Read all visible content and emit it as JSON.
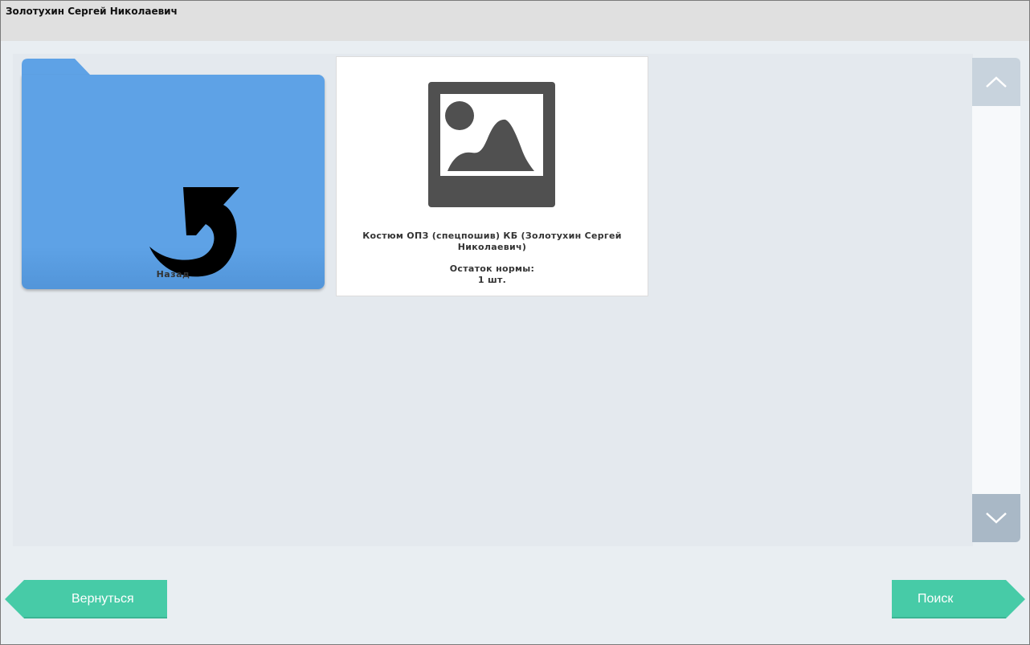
{
  "header": {
    "title": "Золотухин Сергей Николаевич"
  },
  "folder": {
    "label": "Назад",
    "icon": "undo-arrow-icon",
    "color": "#5ea2e6"
  },
  "item_card": {
    "image_icon": "image-placeholder-icon",
    "title": "Костюм ОПЗ (спецпошив) КБ (Золотухин Сергей Николаевич)",
    "stock_label": "Остаток нормы:",
    "stock_value": "1 шт."
  },
  "scrollbar": {
    "up_icon": "chevron-up-icon",
    "down_icon": "chevron-down-icon"
  },
  "footer": {
    "back_label": "Вернуться",
    "search_label": "Поиск",
    "button_color": "#47cba7"
  }
}
